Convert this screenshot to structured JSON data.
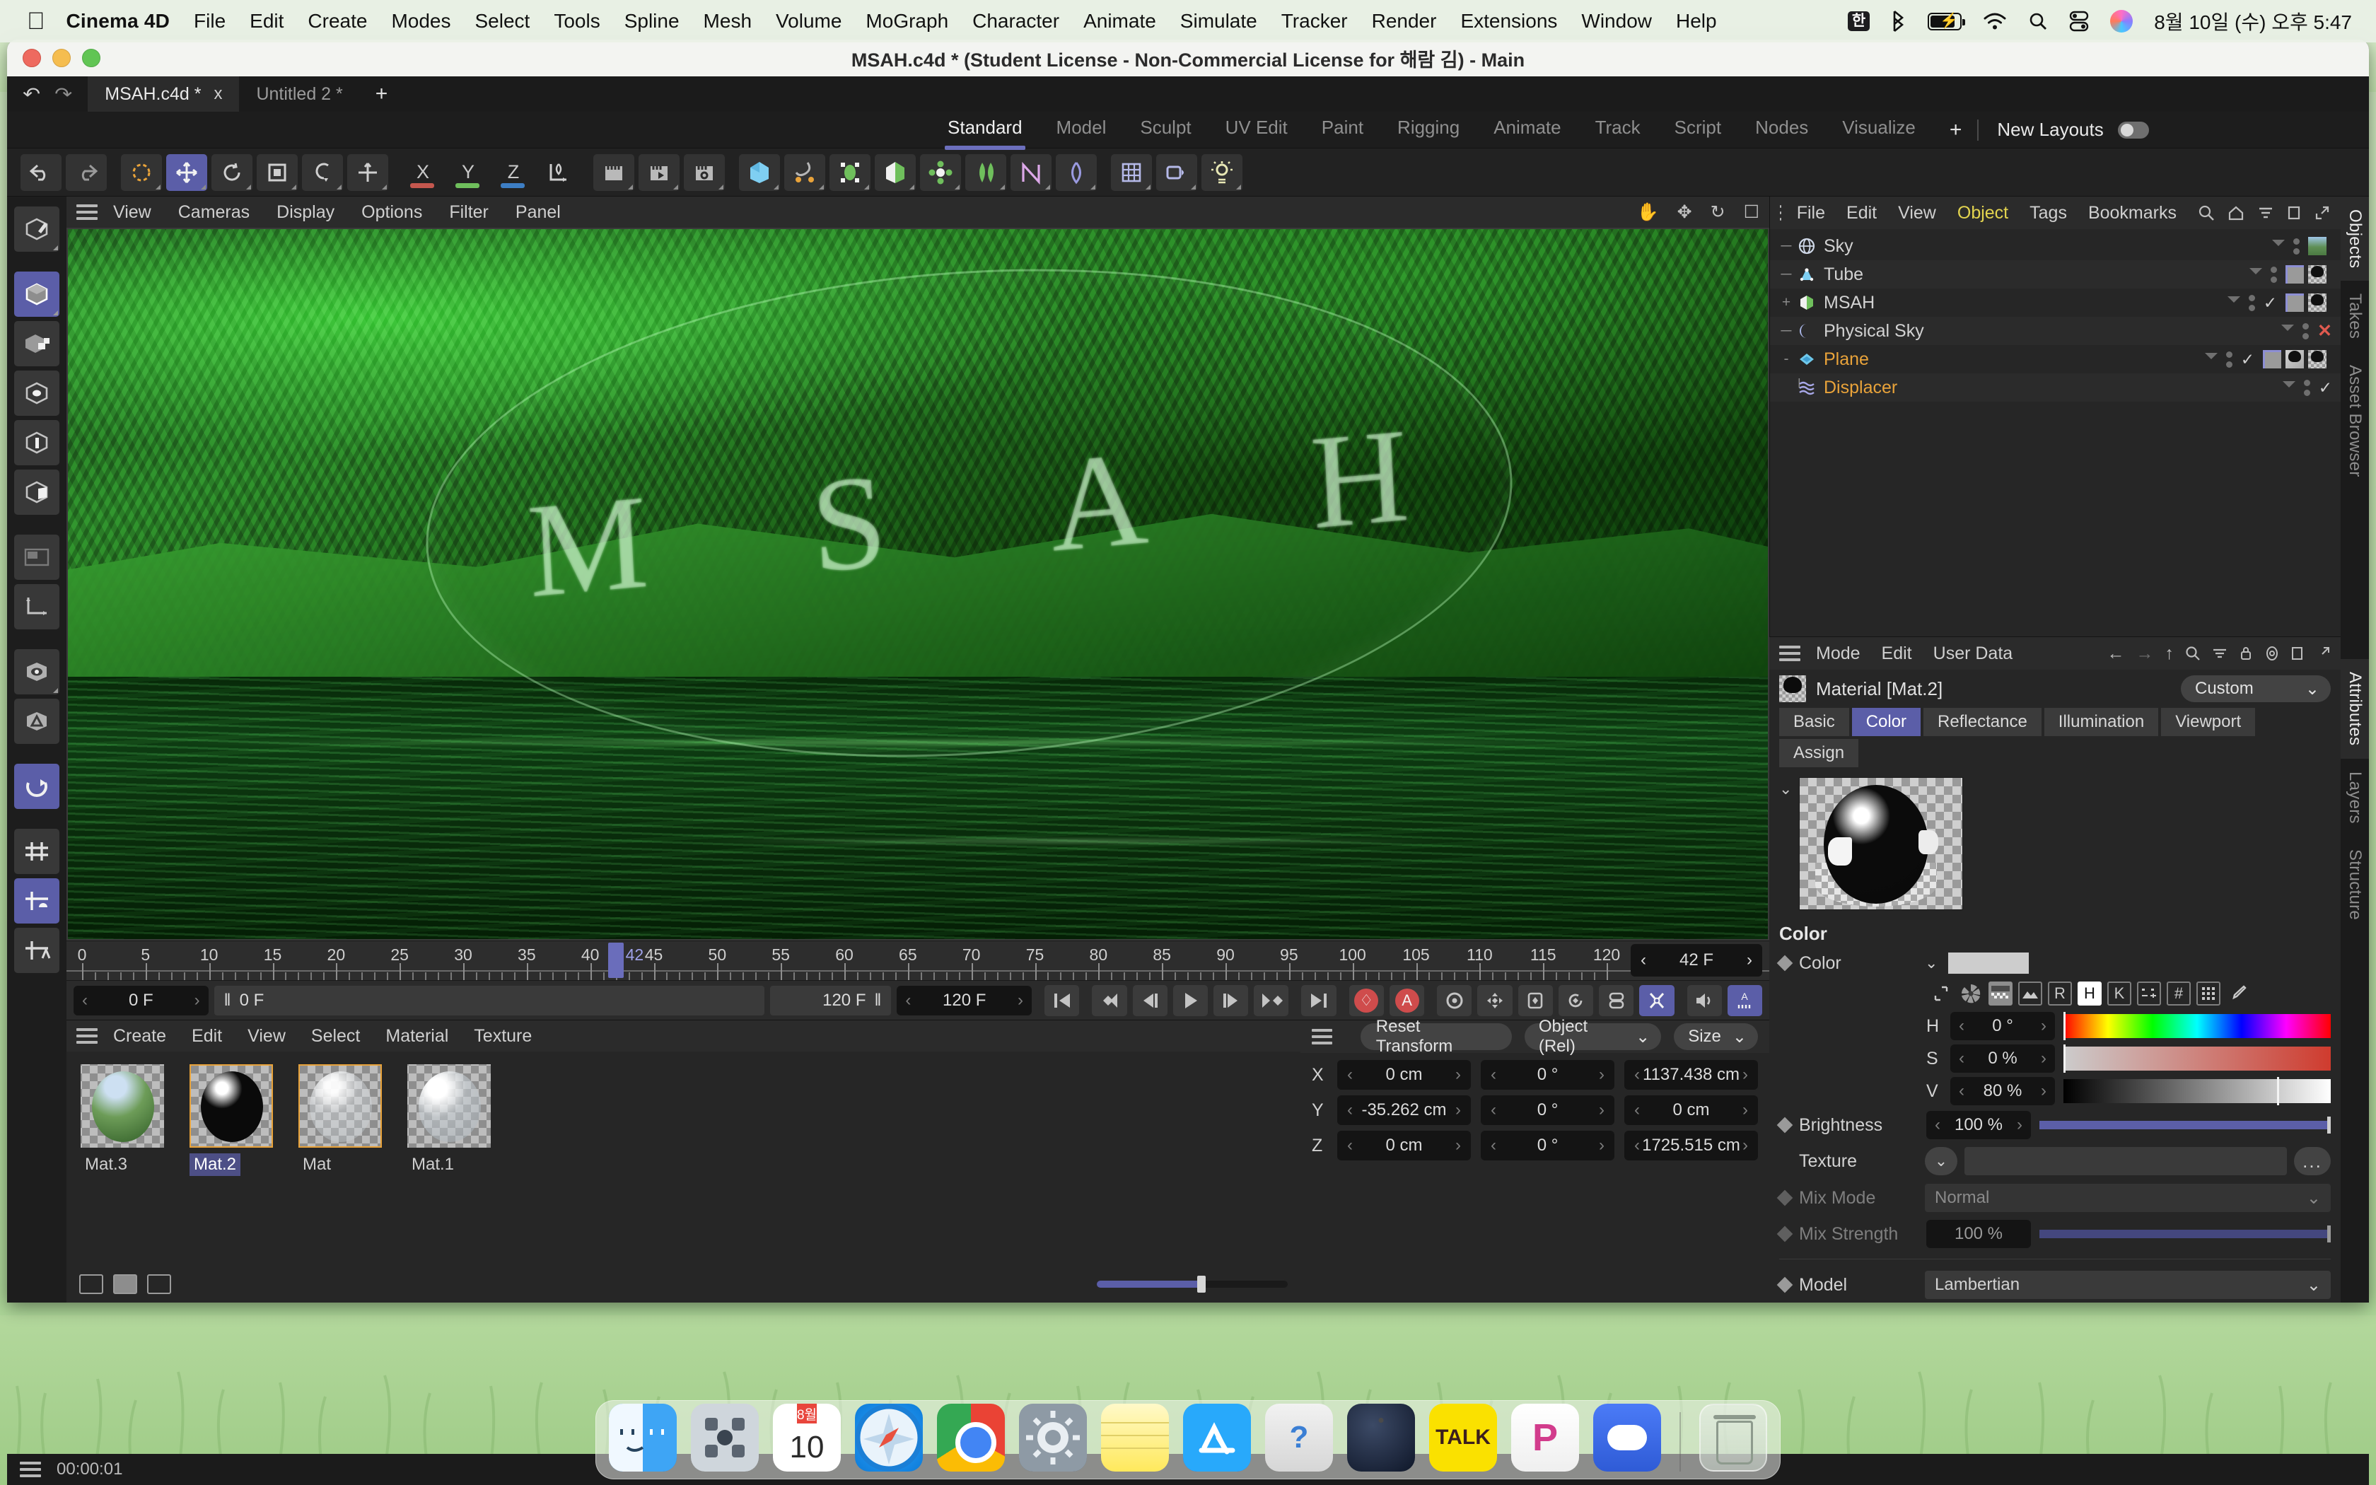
{
  "menubar": {
    "apple_icon": "apple-icon",
    "app_name": "Cinema 4D",
    "items": [
      "File",
      "Edit",
      "Create",
      "Modes",
      "Select",
      "Tools",
      "Spline",
      "Mesh",
      "Volume",
      "MoGraph",
      "Character",
      "Animate",
      "Simulate",
      "Tracker",
      "Render",
      "Extensions",
      "Window",
      "Help"
    ],
    "status_icons": [
      "input-source-korean-icon",
      "bluetooth-icon",
      "battery-charging-icon",
      "wifi-icon",
      "search-icon",
      "control-center-icon",
      "siri-icon"
    ],
    "input_source_label": "한",
    "clock": "8월 10일 (수) 오후 5:47"
  },
  "window": {
    "title": "MSAH.c4d * (Student License - Non-Commercial License for 해람 김) - Main",
    "traffic_lights": [
      "close-button",
      "minimize-button",
      "maximize-button"
    ]
  },
  "tabstrip": {
    "undo_icon": "undo-icon",
    "redo_icon": "redo-icon",
    "documents": [
      {
        "label": "MSAH.c4d *",
        "active": true,
        "close": "x"
      },
      {
        "label": "Untitled 2 *",
        "active": false
      }
    ],
    "add_label": "+"
  },
  "layoutbar": {
    "tabs": [
      "Standard",
      "Model",
      "Sculpt",
      "UV Edit",
      "Paint",
      "Rigging",
      "Animate",
      "Track",
      "Script",
      "Nodes",
      "Visualize"
    ],
    "active_tab": "Standard",
    "add_label": "+",
    "new_layouts_label": "New Layouts"
  },
  "maintoolbar": {
    "groups": [
      [
        "undo-icon",
        "redo-icon"
      ],
      [
        "live-selection-icon",
        "move-icon",
        "rotate-icon",
        "scale-icon",
        "snapping-icon"
      ],
      [
        "move-tool-icon"
      ],
      [
        "axis-x-lock-icon",
        "axis-y-lock-icon",
        "axis-z-lock-icon",
        "world-axis-icon"
      ],
      [
        "render-view-icon",
        "render-region-icon",
        "render-settings-icon"
      ],
      [
        "cube-primitive-icon",
        "spline-pen-icon",
        "generator-icon",
        "deformer-icon",
        "mograph-icon",
        "bend-icon",
        "mograph-effector-icon",
        "simulation-icon",
        "light-grid-icon",
        "camera-icon",
        "light-icon"
      ]
    ],
    "axis_labels": [
      "X",
      "Y",
      "Z"
    ],
    "axis_colors": [
      "#c4574e",
      "#6fbf5c",
      "#3d7ec4"
    ]
  },
  "lefttoolbar": {
    "items": [
      {
        "name": "make-editable-icon",
        "active": false
      },
      {
        "name": "model-mode-icon",
        "active": true
      },
      {
        "name": "object-axis-mode-icon",
        "active": false
      },
      {
        "name": "point-mode-icon",
        "active": false
      },
      {
        "name": "edge-mode-icon",
        "active": false
      },
      {
        "name": "polygon-mode-icon",
        "active": false
      },
      {
        "name": "texture-mode-icon",
        "active": false
      },
      {
        "name": "workplane-icon",
        "active": false
      },
      {
        "name": "viewport-solo-icon",
        "active": false
      },
      {
        "name": "automatic-mode-icon",
        "active": false
      },
      {
        "name": "enable-axis-modification-icon",
        "active": true
      },
      {
        "name": "lock-workplane-icon",
        "active": false
      },
      {
        "name": "workplane-snap-icon",
        "active": true
      },
      {
        "name": "workplane-auto-icon",
        "active": false
      }
    ]
  },
  "viewport": {
    "menus": [
      "View",
      "Cameras",
      "Display",
      "Options",
      "Filter",
      "Panel"
    ],
    "right_icons": [
      "pan-hand-icon",
      "move-axis-icon",
      "rotate-view-icon",
      "maximize-view-icon"
    ],
    "render_text": "MSAH",
    "letters": [
      "M",
      "S",
      "A",
      "H"
    ]
  },
  "timeline": {
    "labels": [
      "0",
      "5",
      "10",
      "15",
      "20",
      "25",
      "30",
      "35",
      "40",
      "45",
      "50",
      "55",
      "60",
      "65",
      "70",
      "75",
      "80",
      "85",
      "90",
      "95",
      "100",
      "105",
      "110",
      "115",
      "120"
    ],
    "min": 0,
    "max": 120,
    "playhead_frame": 42,
    "playhead_label": "42",
    "current_frame_field": "42 F"
  },
  "transport": {
    "start_field": "0 F",
    "preview_start_field": "0 F",
    "end_field_left": "120 F",
    "end_field": "120 F",
    "buttons": [
      {
        "name": "go-to-start-button",
        "glyph": "|◀"
      },
      {
        "name": "previous-key-button",
        "glyph": "◁◀"
      },
      {
        "name": "previous-frame-button",
        "glyph": "◀|"
      },
      {
        "name": "play-button",
        "glyph": "▶"
      },
      {
        "name": "next-frame-button",
        "glyph": "|▶"
      },
      {
        "name": "next-key-button",
        "glyph": "▶▷"
      },
      {
        "name": "go-to-end-button",
        "glyph": "▶|"
      },
      {
        "name": "record-keyframe-button",
        "glyph": "◇"
      },
      {
        "name": "autokeying-button",
        "glyph": "A"
      },
      {
        "name": "keyframe-selection-button",
        "glyph": "⚙"
      },
      {
        "name": "position-key-button",
        "glyph": "✥"
      },
      {
        "name": "scale-key-button",
        "glyph": "⧉"
      },
      {
        "name": "rotation-key-button",
        "glyph": "⟳"
      },
      {
        "name": "parameter-key-button",
        "glyph": "▤"
      },
      {
        "name": "point-level-animation-button",
        "glyph": "✖"
      },
      {
        "name": "sound-button",
        "glyph": "🔊"
      },
      {
        "name": "animation-mode-button",
        "glyph": "A"
      }
    ],
    "active_buttons": [
      "point-level-animation-button",
      "animation-mode-button"
    ]
  },
  "material_manager": {
    "menus": [
      "Create",
      "Edit",
      "View",
      "Select",
      "Material",
      "Texture"
    ],
    "materials": [
      {
        "label": "Mat.3",
        "selected": false,
        "outlined": false,
        "kind": "sky-photo"
      },
      {
        "label": "Mat.2",
        "selected": true,
        "outlined": true,
        "kind": "black-gloss"
      },
      {
        "label": "Mat",
        "selected": false,
        "outlined": true,
        "kind": "clear-glass"
      },
      {
        "label": "Mat.1",
        "selected": false,
        "outlined": false,
        "kind": "rough-glass"
      }
    ],
    "view_modes": [
      "list-view-icon",
      "grid-view-icon",
      "large-view-icon"
    ],
    "active_view_mode": "grid-view-icon",
    "zoom_slider_percent": 55
  },
  "coordinates": {
    "reset_label": "Reset Transform",
    "space_dropdown": "Object (Rel)",
    "dimension_dropdown": "Size",
    "rows": [
      {
        "axis": "X",
        "position": "0 cm",
        "rotation": "0 °",
        "size": "1137.438 cm"
      },
      {
        "axis": "Y",
        "position": "-35.262 cm",
        "rotation": "0 °",
        "size": "0 cm"
      },
      {
        "axis": "Z",
        "position": "0 cm",
        "rotation": "0 °",
        "size": "1725.515 cm"
      }
    ]
  },
  "object_manager": {
    "menus": [
      "File",
      "Edit",
      "View",
      "Object",
      "Tags",
      "Bookmarks"
    ],
    "active_menu": "Object",
    "right_icons": [
      "search-icon",
      "home-icon",
      "filter-icon",
      "detach-icon",
      "expand-icon"
    ],
    "objects": [
      {
        "name": "Sky",
        "icon": "sky-globe-icon",
        "tree": "",
        "selected": false,
        "visibility_dots": 2,
        "status": "none",
        "tags": [
          "sky-texture"
        ]
      },
      {
        "name": "Tube",
        "icon": "tube-icon",
        "tree": "",
        "selected": false,
        "visibility_dots": 2,
        "status": "none",
        "tags": [
          "flag",
          "texture"
        ]
      },
      {
        "name": "MSAH",
        "icon": "extrude-icon",
        "tree": "+",
        "selected": false,
        "visibility_dots": 2,
        "status": "check",
        "tags": [
          "flag",
          "texture"
        ]
      },
      {
        "name": "Physical Sky",
        "icon": "physical-sky-icon",
        "tree": "",
        "selected": false,
        "visibility_dots": 2,
        "status": "x",
        "tags": []
      },
      {
        "name": "Plane",
        "icon": "plane-icon",
        "tree": "-",
        "selected": true,
        "visibility_dots": 2,
        "status": "check",
        "tags": [
          "flag",
          "texture-clear",
          "texture"
        ]
      },
      {
        "name": "Displacer",
        "icon": "displacer-icon",
        "tree": "",
        "selected": true,
        "visibility_dots": 2,
        "status": "check",
        "tags": [],
        "child": true
      }
    ]
  },
  "attributes": {
    "menus": [
      "Mode",
      "Edit",
      "User Data"
    ],
    "right_icons": [
      "back-arrow-icon",
      "forward-arrow-icon",
      "up-arrow-icon",
      "search-icon",
      "filter-icon",
      "lock-icon",
      "target-icon",
      "detach-icon",
      "expand-icon"
    ],
    "title": "Material [Mat.2]",
    "preset_dropdown": "Custom",
    "tabs": [
      "Basic",
      "Color",
      "Reflectance",
      "Illumination",
      "Viewport"
    ],
    "active_tab": "Color",
    "tabs_row2": [
      "Assign"
    ],
    "section_title": "Color",
    "color_row_label": "Color",
    "color_swatch_hex": "#cdcdcd",
    "color_mode_buttons": [
      {
        "name": "color-corner-icon",
        "label": "⌐",
        "active": false
      },
      {
        "name": "color-wheel-icon",
        "label": "✵",
        "active": false
      },
      {
        "name": "color-gradient-icon",
        "label": "▦",
        "active": false
      },
      {
        "name": "color-image-icon",
        "label": "🖼",
        "active": false
      },
      {
        "name": "color-rgb-button",
        "label": "R",
        "active": false
      },
      {
        "name": "color-hsv-button",
        "label": "H",
        "active": true
      },
      {
        "name": "color-kelvin-button",
        "label": "K",
        "active": false
      },
      {
        "name": "color-mixer-button",
        "label": "⋯",
        "active": false
      },
      {
        "name": "color-hex-button",
        "label": "#",
        "active": false
      },
      {
        "name": "color-numpad-button",
        "label": "⠿",
        "active": false
      },
      {
        "name": "color-picker-eyedropper-icon",
        "label": "⟋",
        "active": false
      }
    ],
    "hsv": [
      {
        "label": "H",
        "value": "0 °",
        "bar": "hue",
        "marker_percent": 0
      },
      {
        "label": "S",
        "value": "0 %",
        "bar": "saturation",
        "marker_percent": 0
      },
      {
        "label": "V",
        "value": "80 %",
        "bar": "value",
        "marker_percent": 80
      }
    ],
    "brightness": {
      "label": "Brightness",
      "value": "100 %",
      "percent": 100
    },
    "texture": {
      "label": "Texture",
      "value": "",
      "more_label": "..."
    },
    "mix_mode": {
      "label": "Mix Mode",
      "value": "Normal"
    },
    "mix_strength": {
      "label": "Mix Strength",
      "value": "100 %",
      "percent": 100
    },
    "model": {
      "label": "Model",
      "value": "Lambertian"
    }
  },
  "side_tabs": {
    "top_group": [
      "Objects",
      "Takes",
      "Asset Browser"
    ],
    "top_active": "Objects",
    "bottom_group": [
      "Attributes",
      "Layers",
      "Structure"
    ],
    "bottom_active": "Attributes"
  },
  "statusbar": {
    "time": "00:00:01",
    "menu_icon": "hamburger-icon"
  },
  "dock": {
    "items": [
      {
        "name": "finder",
        "label": "Finder",
        "running": true
      },
      {
        "name": "launchpad",
        "label": "Launchpad",
        "running": false
      },
      {
        "name": "calendar",
        "label": "Calendar",
        "running": false,
        "month": "8월",
        "day": "10"
      },
      {
        "name": "safari",
        "label": "Safari",
        "running": false
      },
      {
        "name": "chrome",
        "label": "Google Chrome",
        "running": false
      },
      {
        "name": "system-preferences",
        "label": "System Preferences",
        "running": false
      },
      {
        "name": "notes",
        "label": "Notes",
        "running": false
      },
      {
        "name": "app-store",
        "label": "App Store",
        "running": false
      },
      {
        "name": "help-viewer",
        "label": "Help",
        "running": false,
        "glyph": "?"
      },
      {
        "name": "cinema-4d",
        "label": "Cinema 4D",
        "running": true
      },
      {
        "name": "kakaotalk",
        "label": "KakaoTalk",
        "running": false,
        "glyph": "TALK"
      },
      {
        "name": "potplayer",
        "label": "PotPlayer",
        "running": false,
        "glyph": "P"
      },
      {
        "name": "messenger",
        "label": "Messenger",
        "running": false
      },
      {
        "name": "trash",
        "label": "Trash",
        "running": false
      }
    ]
  },
  "colors": {
    "accent_purple": "#5b5ea8",
    "selected_orange": "#e9a33a",
    "active_yellow": "#e3d44f",
    "record_red": "#cf4c4c",
    "panel_bg": "#262626",
    "header_bg": "#2b2b2b"
  }
}
